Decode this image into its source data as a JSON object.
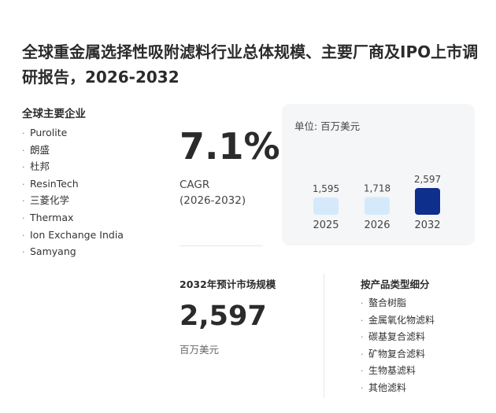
{
  "title": "全球重金属选择性吸附滤料行业总体规模、主要厂商及IPO上市调研报告，2026-2032",
  "companies": {
    "heading": "全球主要企业",
    "items": [
      "Purolite",
      "朗盛",
      "杜邦",
      "ResinTech",
      "三菱化学",
      "Thermax",
      "Ion Exchange India",
      "Samyang"
    ]
  },
  "cagr": {
    "value": "7.1%",
    "label": "CAGR",
    "period": "(2026-2032)"
  },
  "chart": {
    "unit": "单位: 百万美元"
  },
  "chart_data": {
    "type": "bar",
    "categories": [
      "2025",
      "2026",
      "2032"
    ],
    "values": [
      1595,
      1718,
      2597
    ],
    "value_labels": [
      "1,595",
      "1,718",
      "2,597"
    ],
    "colors": [
      "#d6e9fb",
      "#d6e9fb",
      "#0f2f8c"
    ],
    "unit": "单位: 百万美元"
  },
  "market": {
    "heading": "2032年预计市场规模",
    "value": "2,597",
    "unit": "百万美元"
  },
  "segments": {
    "heading": "按产品类型细分",
    "items": [
      "螯合树脂",
      "金属氧化物滤料",
      "碳基复合滤料",
      "矿物复合滤料",
      "生物基滤料",
      "其他滤料"
    ]
  }
}
